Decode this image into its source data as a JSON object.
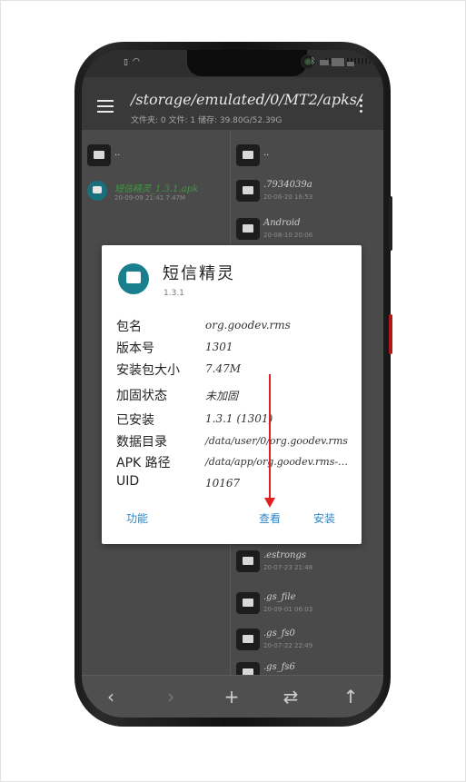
{
  "status_bar": {
    "icons": [
      "sim-icon",
      "wifi-icon",
      "bluetooth-icon"
    ]
  },
  "app_bar": {
    "path": "/storage/emulated/0/MT2/apks/",
    "summary": "文件夹: 0  文件: 1  储存: 39.80G/52.39G"
  },
  "left_pane": {
    "parent": "..",
    "apk": {
      "name": "短信精灵_1.3.1.apk",
      "meta": "20-09-09 21:41  7.47M"
    }
  },
  "right_pane": {
    "parent": "..",
    "folders": [
      {
        "name": ".7934039a",
        "meta": "20-06-20 16:53"
      },
      {
        "name": "Android",
        "meta": "20-08-10 20:06"
      },
      {
        "name": ".estrongs",
        "meta": "20-07-23 21:48"
      },
      {
        "name": ".gs_file",
        "meta": "20-09-01 06:03"
      },
      {
        "name": ".gs_fs0",
        "meta": "20-07-22 22:49"
      },
      {
        "name": ".gs_fs6",
        "meta": ""
      }
    ]
  },
  "bottom_bar": {
    "back": "‹",
    "forward": "›",
    "add": "+",
    "swap": "⇄",
    "up": "↑"
  },
  "dialog": {
    "title": "短信精灵",
    "version": "1.3.1",
    "rows": [
      {
        "label": "包名",
        "value": "org.goodev.rms"
      },
      {
        "label": "版本号",
        "value": "1301"
      },
      {
        "label": "安装包大小",
        "value": "7.47M"
      },
      {
        "label": "加固状态",
        "value": "未加固"
      },
      {
        "label": "已安装",
        "value": "1.3.1 (1301)"
      },
      {
        "label": "数据目录",
        "value": "/data/user/0/org.goodev.rms"
      },
      {
        "label": "APK 路径",
        "value": "/data/app/org.goodev.rms-…"
      },
      {
        "label": "UID",
        "value": "10167"
      }
    ],
    "buttons": {
      "function": "功能",
      "view": "查看",
      "install": "安装"
    }
  },
  "colors": {
    "accent": "#2f86c6",
    "app_icon": "#1a7f8c",
    "annotation_arrow": "#e02020"
  }
}
